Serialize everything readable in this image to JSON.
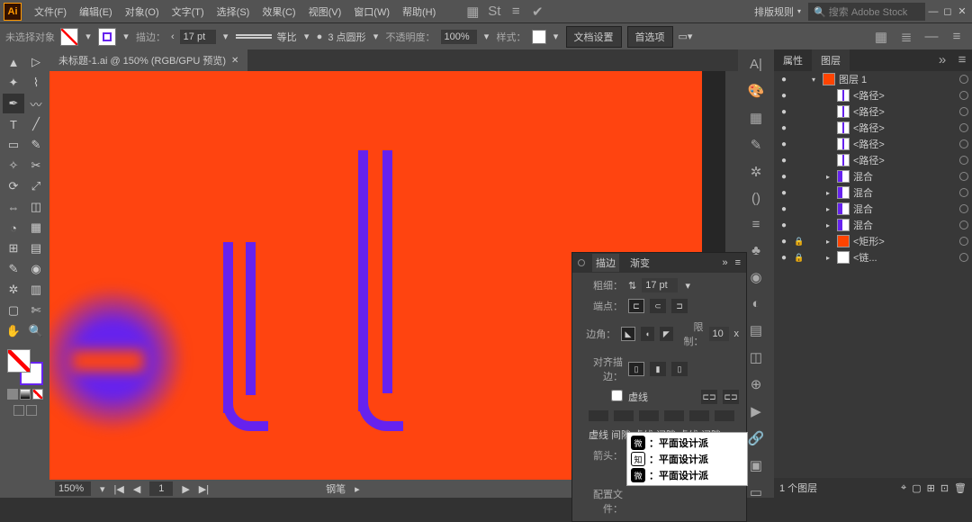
{
  "menu": {
    "file": "文件(F)",
    "edit": "编辑(E)",
    "object": "对象(O)",
    "type": "文字(T)",
    "select": "选择(S)",
    "effect": "效果(C)",
    "view": "视图(V)",
    "window": "窗口(W)",
    "help": "帮助(H)"
  },
  "workspace": "排版规则",
  "search_placeholder": "搜索 Adobe Stock",
  "control": {
    "no_sel": "未选择对象",
    "stroke_label": "描边：",
    "stroke_val": "17 pt",
    "profile": "等比",
    "dot": "●",
    "brush": "3 点圆形",
    "opacity_label": "不透明度：",
    "opacity_val": "100%",
    "style_label": "样式：",
    "doc_setup": "文档设置",
    "prefs": "首选项"
  },
  "doc_tab": "未标题-1.ai @ 150% (RGB/GPU 预览)",
  "status": {
    "zoom": "150%",
    "page": "1",
    "tool": "钢笔"
  },
  "panel_tabs": {
    "properties": "属性",
    "layers": "图层"
  },
  "layers": [
    {
      "ind": 0,
      "tw": "▾",
      "sw": "sw-orange",
      "name": "图层 1",
      "vis": "●",
      "lock": ""
    },
    {
      "ind": 1,
      "tw": "",
      "sw": "sw-pathA",
      "name": "<路径>",
      "vis": "●",
      "lock": ""
    },
    {
      "ind": 1,
      "tw": "",
      "sw": "sw-pathA",
      "name": "<路径>",
      "vis": "●",
      "lock": ""
    },
    {
      "ind": 1,
      "tw": "",
      "sw": "sw-pathA",
      "name": "<路径>",
      "vis": "●",
      "lock": ""
    },
    {
      "ind": 1,
      "tw": "",
      "sw": "sw-pathA",
      "name": "<路径>",
      "vis": "●",
      "lock": ""
    },
    {
      "ind": 1,
      "tw": "",
      "sw": "sw-pathA",
      "name": "<路径>",
      "vis": "●",
      "lock": ""
    },
    {
      "ind": 1,
      "tw": "▸",
      "sw": "sw-mix",
      "name": "混合",
      "vis": "●",
      "lock": ""
    },
    {
      "ind": 1,
      "tw": "▸",
      "sw": "sw-mix",
      "name": "混合",
      "vis": "●",
      "lock": ""
    },
    {
      "ind": 1,
      "tw": "▸",
      "sw": "sw-mix",
      "name": "混合",
      "vis": "●",
      "lock": ""
    },
    {
      "ind": 1,
      "tw": "▸",
      "sw": "sw-mix",
      "name": "混合",
      "vis": "●",
      "lock": ""
    },
    {
      "ind": 1,
      "tw": "▸",
      "sw": "sw-rect",
      "name": "<矩形>",
      "vis": "●",
      "lock": "🔒"
    },
    {
      "ind": 1,
      "tw": "▸",
      "sw": "sw-link",
      "name": "<链...",
      "vis": "●",
      "lock": "🔒"
    }
  ],
  "layers_footer": "1 个图层",
  "stroke_panel": {
    "tab_stroke": "描边",
    "tab_grad": "渐变",
    "weight_l": "粗细：",
    "weight_v": "17 pt",
    "cap_l": "端点：",
    "corner_l": "边角：",
    "limit_l": "限制：",
    "limit_v": "10",
    "limit_x": "x",
    "align_l": "对齐描边：",
    "dash_l": "虚线",
    "lbl_dash": "虚线",
    "lbl_gap": "间隙",
    "arrow_l": "箭头：",
    "config_l": "配置文件："
  },
  "overlay": {
    "t1": "：平面设计派",
    "t2": "：平面设计派",
    "t3": "：平面设计派"
  }
}
